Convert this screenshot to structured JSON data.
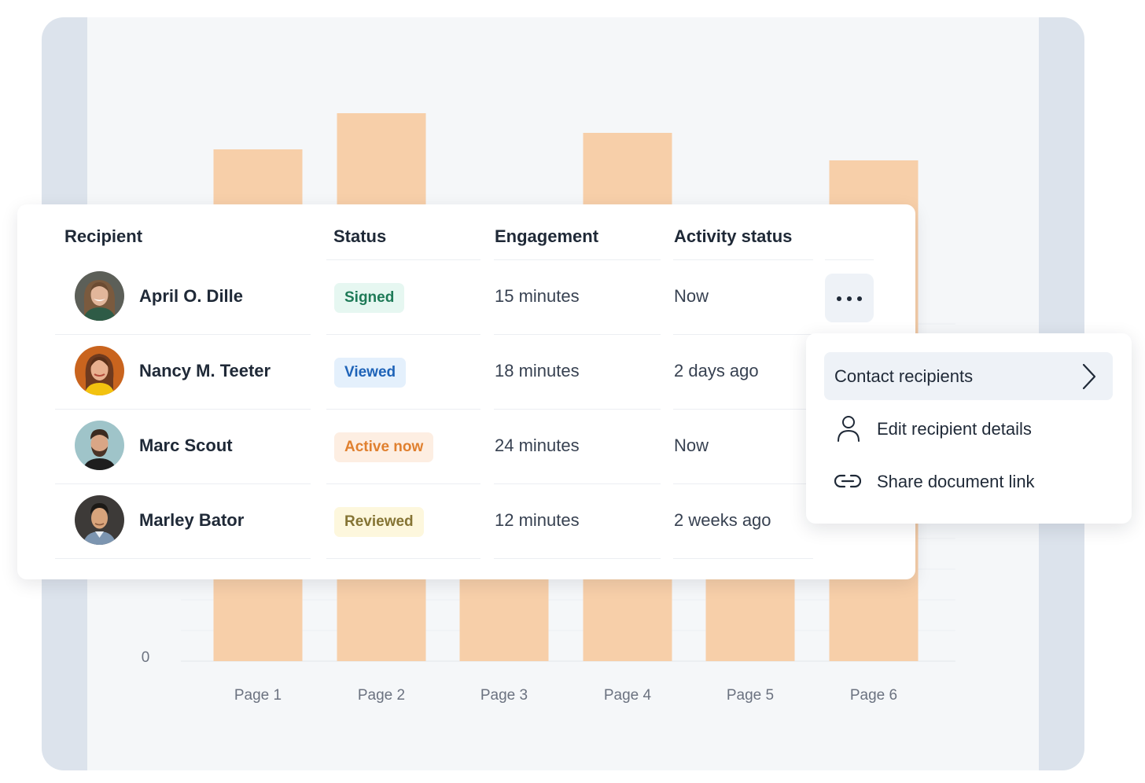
{
  "chart_data": {
    "type": "bar",
    "categories": [
      "Page 1",
      "Page 2",
      "Page 3",
      "Page 4",
      "Page 5",
      "Page 6"
    ],
    "values": [
      1,
      1,
      0.5,
      1,
      0.5,
      1
    ],
    "ytick_labels": [
      "0"
    ],
    "grid": true,
    "bar_color": "#f7cfa9",
    "note_values": "relative bar heights: bars for Page 3 and Page 5 are hidden behind the table card"
  },
  "table": {
    "headers": {
      "recipient": "Recipient",
      "status": "Status",
      "engagement": "Engagement",
      "activity": "Activity status"
    },
    "rows": [
      {
        "name": "April O. Dille",
        "status": "Signed",
        "status_color": "green",
        "engagement": "15 minutes",
        "activity": "Now",
        "avatar": "woman-smiling-green-top"
      },
      {
        "name": "Nancy M. Teeter",
        "status": "Viewed",
        "status_color": "blue",
        "engagement": "18 minutes",
        "activity": "2 days ago",
        "avatar": "woman-yellow-top"
      },
      {
        "name": "Marc Scout",
        "status": "Active now",
        "status_color": "orange",
        "engagement": "24 minutes",
        "activity": "Now",
        "avatar": "man-beard-dark-shirt"
      },
      {
        "name": "Marley Bator",
        "status": "Reviewed",
        "status_color": "yellow",
        "engagement": "12 minutes",
        "activity": "2 weeks ago",
        "avatar": "man-denim-shirt"
      }
    ]
  },
  "more_button": {
    "icon": "more-horizontal-icon"
  },
  "menu": {
    "items": [
      {
        "label": "Contact recipients",
        "icon": "chevron-right-icon",
        "active": true
      },
      {
        "label": "Edit recipient details",
        "icon": "user-icon",
        "active": false
      },
      {
        "label": "Share document link",
        "icon": "link-icon",
        "active": false
      }
    ]
  },
  "colors": {
    "accent_bar": "#f7cfa9",
    "background": "#f5f7f9",
    "frame": "#dce3ec"
  }
}
